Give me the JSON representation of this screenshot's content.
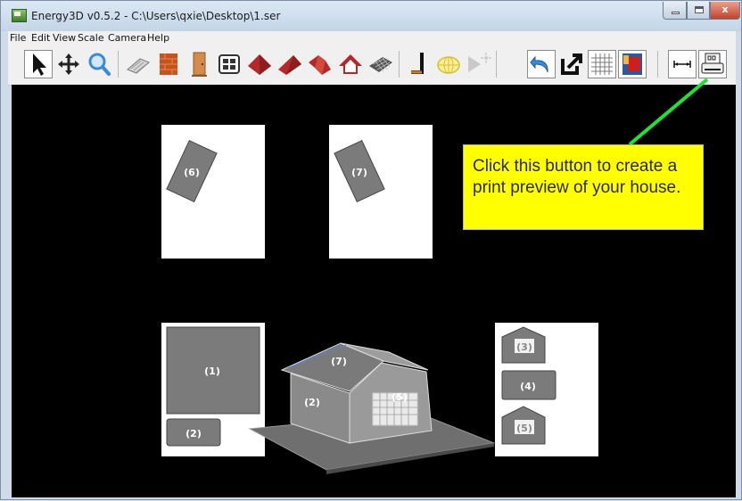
{
  "window": {
    "title": "Energy3D v0.5.2 - C:\\Users\\qxie\\Desktop\\1.ser",
    "close_label": "x"
  },
  "menu": {
    "items": [
      "File",
      "Edit",
      "View",
      "Scale",
      "Camera",
      "Help"
    ]
  },
  "toolbar": {
    "buttons": [
      "select-arrow-icon",
      "move-icon",
      "zoom-icon",
      "foundation-icon",
      "wall-icon",
      "door-icon",
      "window-icon",
      "hip-roof-icon",
      "pyramid-roof-icon",
      "gable-roof-icon",
      "custom-roof-icon",
      "floor-icon",
      "heliodon-pole-icon",
      "sun-angle-icon",
      "sun-icon",
      "undo-icon",
      "annotation-icon",
      "grid-icon",
      "solar-map-icon",
      "measure-icon",
      "print-preview-icon"
    ]
  },
  "colors": {
    "accent_callout": "#ffff00",
    "pointer_line": "#22e03a",
    "piece_fill": "#7b7b7b",
    "viewport_bg": "#000000"
  },
  "pieces": {
    "p6": "(6)",
    "p7_top": "(7)",
    "p1": "(1)",
    "p2_left": "(2)",
    "p3": "(3)",
    "p4": "(4)",
    "p5_right": "(5)",
    "house_roof": "(7)",
    "house_wall": "(2)",
    "house_window": "(5)"
  },
  "callout": {
    "text": "Click this button to create a print preview of your house."
  }
}
